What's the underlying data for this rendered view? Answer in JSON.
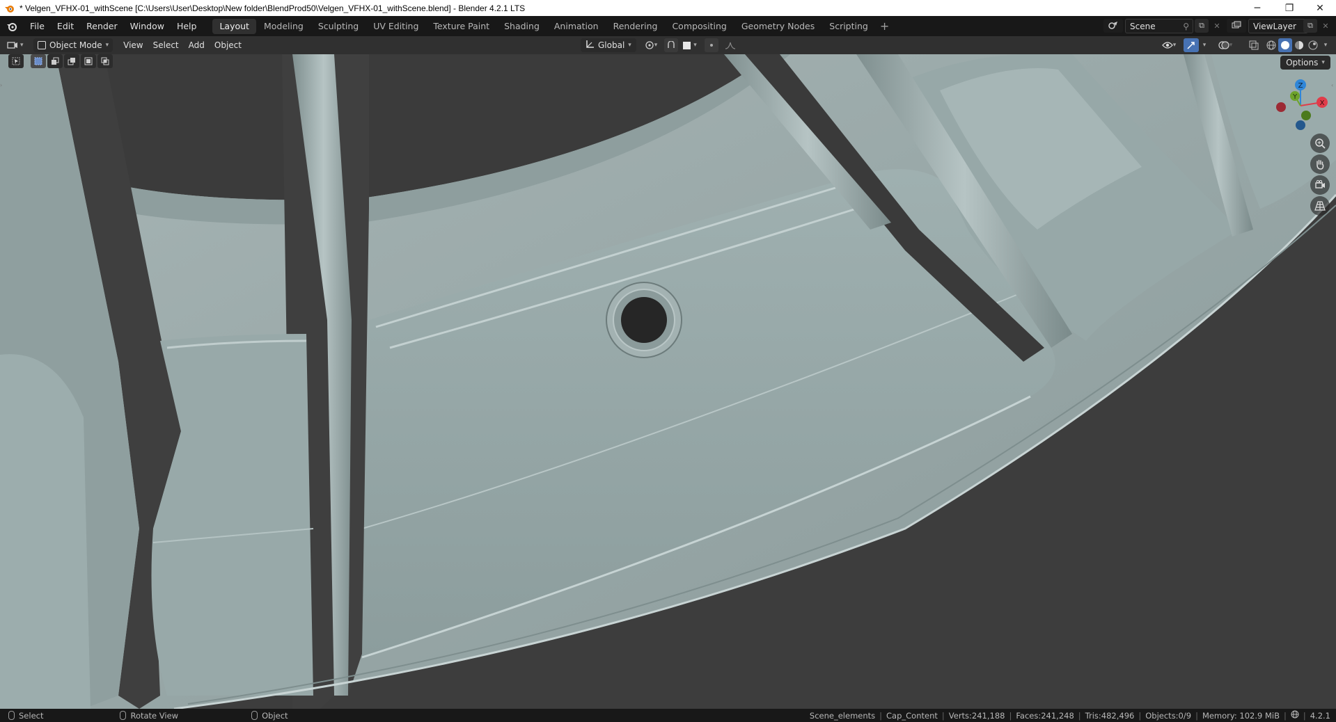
{
  "window": {
    "title": "* Velgen_VFHX-01_withScene [C:\\Users\\User\\Desktop\\New folder\\BlendProd50\\Velgen_VFHX-01_withScene.blend] - Blender 4.2.1 LTS",
    "minimize": "─",
    "restore": "❐",
    "close": "✕"
  },
  "menu": {
    "file": "File",
    "edit": "Edit",
    "render": "Render",
    "window": "Window",
    "help": "Help"
  },
  "workspaces": [
    "Layout",
    "Modeling",
    "Sculpting",
    "UV Editing",
    "Texture Paint",
    "Shading",
    "Animation",
    "Rendering",
    "Compositing",
    "Geometry Nodes",
    "Scripting"
  ],
  "active_workspace": "Layout",
  "scene": {
    "name": "Scene"
  },
  "view_layer": {
    "name": "ViewLayer"
  },
  "viewport_header": {
    "mode": "Object Mode",
    "view": "View",
    "select": "Select",
    "add": "Add",
    "object": "Object",
    "orientation": "Global"
  },
  "options_label": "Options",
  "gizmo": {
    "x": "X",
    "y": "Y",
    "z": "Z"
  },
  "status": {
    "hint_select": "Select",
    "hint_rotate": "Rotate View",
    "hint_object": "Object",
    "collection": "Scene_elements",
    "active_object": "Cap_Content",
    "verts": "Verts:241,188",
    "faces": "Faces:241,248",
    "tris": "Tris:482,496",
    "objects": "Objects:0/9",
    "memory": "Memory: 102.9 MiB",
    "version": "4.2.1"
  },
  "colors": {
    "accent_blue": "#4772b3",
    "axis_x": "#e03c4a",
    "axis_y": "#6ea32b",
    "axis_z": "#2f86d8"
  }
}
